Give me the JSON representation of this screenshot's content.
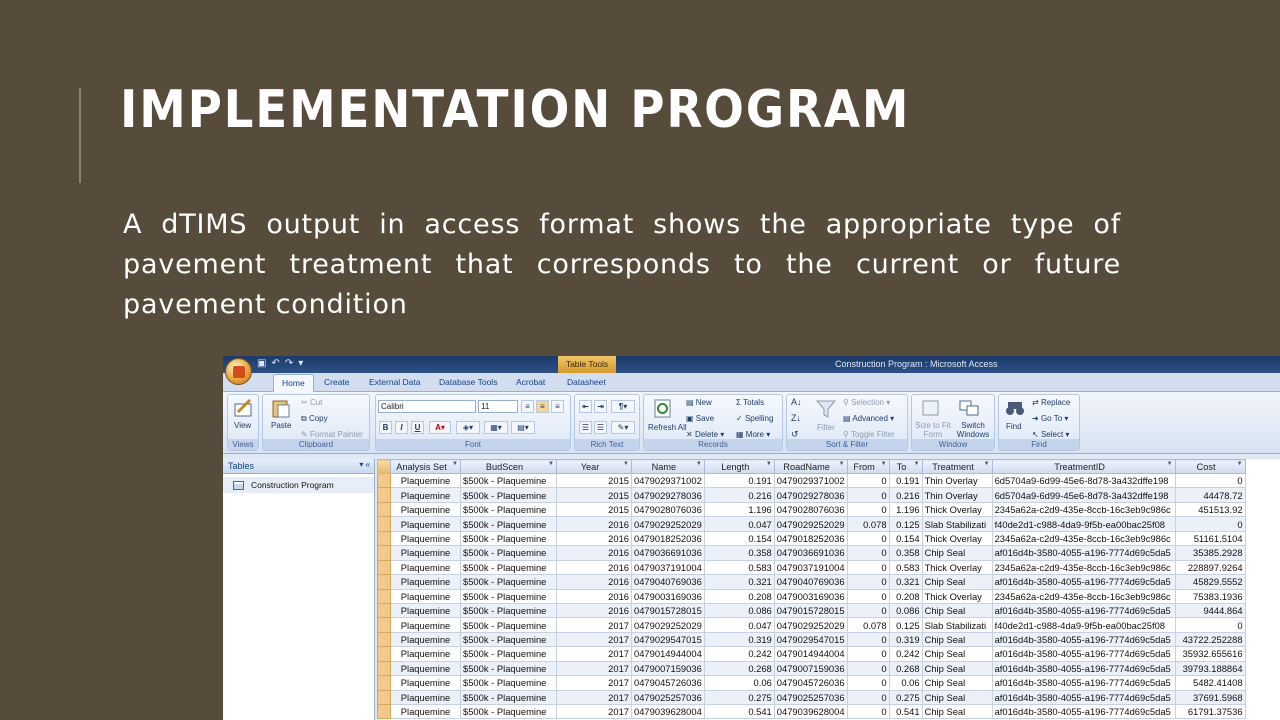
{
  "slide": {
    "title": "IMPLEMENTATION PROGRAM",
    "body": "A dTIMS output in access format shows the appropriate type of pavement treatment that corresponds to the current or future pavement condition"
  },
  "window": {
    "title": "Construction Program : Microsoft Access",
    "context_tab": "Table Tools",
    "tabs": [
      "Home",
      "Create",
      "External Data",
      "Database Tools",
      "Acrobat",
      "Datasheet"
    ]
  },
  "ribbon": {
    "views": {
      "label": "Views",
      "view": "View"
    },
    "clipboard": {
      "label": "Clipboard",
      "paste": "Paste",
      "cut": "Cut",
      "copy": "Copy",
      "format_painter": "Format Painter"
    },
    "font": {
      "label": "Font",
      "family": "Calibri",
      "size": "11",
      "bold": "B",
      "italic": "I",
      "underline": "U"
    },
    "rich_text": {
      "label": "Rich Text"
    },
    "records": {
      "label": "Records",
      "refresh": "Refresh All",
      "new": "New",
      "save": "Save",
      "delete": "Delete",
      "totals": "Totals",
      "spelling": "Spelling",
      "more": "More"
    },
    "sort_filter": {
      "label": "Sort & Filter",
      "filter": "Filter",
      "selection": "Selection",
      "advanced": "Advanced",
      "toggle": "Toggle Filter"
    },
    "window": {
      "label": "Window",
      "size_fit": "Size to Fit Form",
      "switch": "Switch Windows"
    },
    "find": {
      "label": "Find",
      "find": "Find",
      "replace": "Replace",
      "goto": "Go To",
      "select": "Select"
    }
  },
  "nav": {
    "header": "Tables",
    "items": [
      "Construction Program"
    ]
  },
  "table": {
    "columns": [
      "Analysis Set",
      "BudScen",
      "Year",
      "Name",
      "Length",
      "RoadName",
      "From",
      "To",
      "Treatment",
      "TreatmentID",
      "Cost"
    ],
    "rows": [
      [
        "Plaquemine",
        "$500k - Plaquemine",
        "2015",
        "0479029371002",
        "0.191",
        "0479029371002",
        "0",
        "0.191",
        "Thin Overlay",
        "6d5704a9-6d99-45e6-8d78-3a432dffe198",
        "0"
      ],
      [
        "Plaquemine",
        "$500k - Plaquemine",
        "2015",
        "0479029278036",
        "0.216",
        "0479029278036",
        "0",
        "0.216",
        "Thin Overlay",
        "6d5704a9-6d99-45e6-8d78-3a432dffe198",
        "44478.72"
      ],
      [
        "Plaquemine",
        "$500k - Plaquemine",
        "2015",
        "0479028076036",
        "1.196",
        "0479028076036",
        "0",
        "1.196",
        "Thick Overlay",
        "2345a62a-c2d9-435e-8ccb-16c3eb9c986c",
        "451513.92"
      ],
      [
        "Plaquemine",
        "$500k - Plaquemine",
        "2016",
        "0479029252029",
        "0.047",
        "0479029252029",
        "0.078",
        "0.125",
        "Slab Stabilizati",
        "f40de2d1-c988-4da9-9f5b-ea00bac25f08",
        "0"
      ],
      [
        "Plaquemine",
        "$500k - Plaquemine",
        "2016",
        "0479018252036",
        "0.154",
        "0479018252036",
        "0",
        "0.154",
        "Thick Overlay",
        "2345a62a-c2d9-435e-8ccb-16c3eb9c986c",
        "51161.5104"
      ],
      [
        "Plaquemine",
        "$500k - Plaquemine",
        "2016",
        "0479036691036",
        "0.358",
        "0479036691036",
        "0",
        "0.358",
        "Chip Seal",
        "af016d4b-3580-4055-a196-7774d69c5da5",
        "35385.2928"
      ],
      [
        "Plaquemine",
        "$500k - Plaquemine",
        "2016",
        "0479037191004",
        "0.583",
        "0479037191004",
        "0",
        "0.583",
        "Thick Overlay",
        "2345a62a-c2d9-435e-8ccb-16c3eb9c986c",
        "228897.9264"
      ],
      [
        "Plaquemine",
        "$500k - Plaquemine",
        "2016",
        "0479040769036",
        "0.321",
        "0479040769036",
        "0",
        "0.321",
        "Chip Seal",
        "af016d4b-3580-4055-a196-7774d69c5da5",
        "45829.5552"
      ],
      [
        "Plaquemine",
        "$500k - Plaquemine",
        "2016",
        "0479003169036",
        "0.208",
        "0479003169036",
        "0",
        "0.208",
        "Thick Overlay",
        "2345a62a-c2d9-435e-8ccb-16c3eb9c986c",
        "75383.1936"
      ],
      [
        "Plaquemine",
        "$500k - Plaquemine",
        "2016",
        "0479015728015",
        "0.086",
        "0479015728015",
        "0",
        "0.086",
        "Chip Seal",
        "af016d4b-3580-4055-a196-7774d69c5da5",
        "9444.864"
      ],
      [
        "Plaquemine",
        "$500k - Plaquemine",
        "2017",
        "0479029252029",
        "0.047",
        "0479029252029",
        "0.078",
        "0.125",
        "Slab Stabilizati",
        "f40de2d1-c988-4da9-9f5b-ea00bac25f08",
        "0"
      ],
      [
        "Plaquemine",
        "$500k - Plaquemine",
        "2017",
        "0479029547015",
        "0.319",
        "0479029547015",
        "0",
        "0.319",
        "Chip Seal",
        "af016d4b-3580-4055-a196-7774d69c5da5",
        "43722.252288"
      ],
      [
        "Plaquemine",
        "$500k - Plaquemine",
        "2017",
        "0479014944004",
        "0.242",
        "0479014944004",
        "0",
        "0.242",
        "Chip Seal",
        "af016d4b-3580-4055-a196-7774d69c5da5",
        "35932.655616"
      ],
      [
        "Plaquemine",
        "$500k - Plaquemine",
        "2017",
        "0479007159036",
        "0.268",
        "0479007159036",
        "0",
        "0.268",
        "Chip Seal",
        "af016d4b-3580-4055-a196-7774d69c5da5",
        "39793.188864"
      ],
      [
        "Plaquemine",
        "$500k - Plaquemine",
        "2017",
        "0479045726036",
        "0.06",
        "0479045726036",
        "0",
        "0.06",
        "Chip Seal",
        "af016d4b-3580-4055-a196-7774d69c5da5",
        "5482.41408"
      ],
      [
        "Plaquemine",
        "$500k - Plaquemine",
        "2017",
        "0479025257036",
        "0.275",
        "0479025257036",
        "0",
        "0.275",
        "Chip Seal",
        "af016d4b-3580-4055-a196-7774d69c5da5",
        "37691.5968"
      ],
      [
        "Plaquemine",
        "$500k - Plaquemine",
        "2017",
        "0479039628004",
        "0.541",
        "0479039628004",
        "0",
        "0.541",
        "Chip Seal",
        "af016d4b-3580-4055-a196-7774d69c5da5",
        "61791.37536"
      ]
    ]
  },
  "colors": {
    "background": "#574b3c",
    "title_bar": "#1c3a68",
    "selector": "#f2c98a"
  }
}
